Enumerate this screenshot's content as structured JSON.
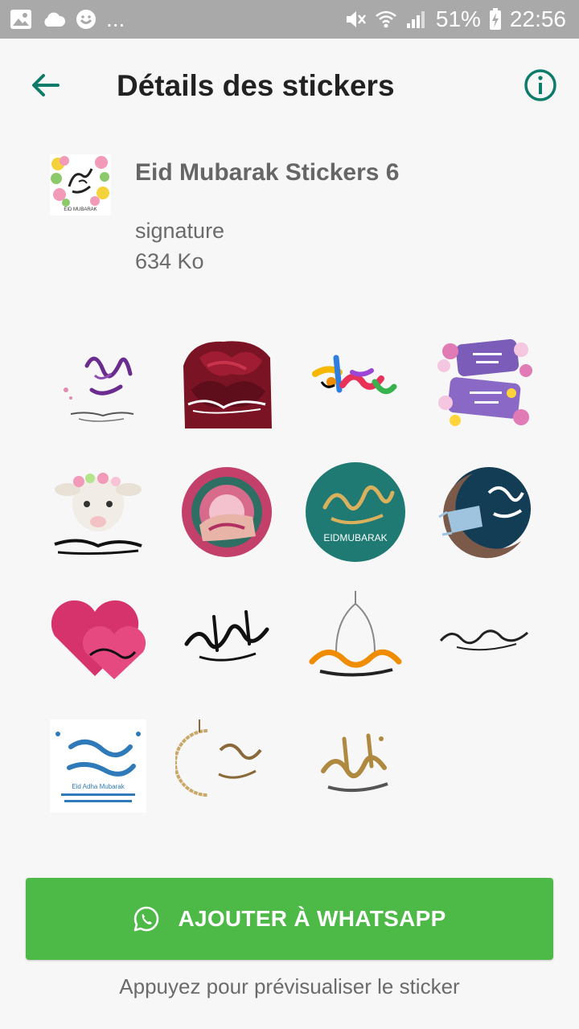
{
  "status_bar": {
    "battery": "51%",
    "time": "22:56",
    "more": "..."
  },
  "app_bar": {
    "title": "Détails des stickers"
  },
  "pack": {
    "name": "Eid Mubarak Stickers 6",
    "author": "signature",
    "size": "634 Ko",
    "thumb_text": "EID MUBARAK"
  },
  "stickers": [
    {
      "icon": "purple-calligraphy-crescent-sticker"
    },
    {
      "icon": "red-rose-calligraphy-sticker"
    },
    {
      "icon": "colorful-eid-calligraphy-sticker"
    },
    {
      "icon": "purple-ribbon-flowers-sticker"
    },
    {
      "icon": "sheep-flower-crown-sticker"
    },
    {
      "icon": "pink-mandala-sticker"
    },
    {
      "icon": "teal-circle-eidmubarak-sticker",
      "label": "EIDMUBARAK"
    },
    {
      "icon": "crescent-mask-sticker"
    },
    {
      "icon": "pink-hearts-sticker"
    },
    {
      "icon": "black-calligraphy-sticker"
    },
    {
      "icon": "mosque-dome-calligraphy-sticker"
    },
    {
      "icon": "small-black-calligraphy-sticker"
    },
    {
      "icon": "eid-adha-blue-card-sticker",
      "label": "Eid Adha Mubarak"
    },
    {
      "icon": "gold-crescent-calligraphy-sticker"
    },
    {
      "icon": "gold-eid-mubarak-sticker"
    }
  ],
  "actions": {
    "add_label": "AJOUTER À WHATSAPP",
    "hint": "Appuyez pour prévisualiser le sticker"
  },
  "colors": {
    "accent": "#0e7c6b",
    "button": "#4db947",
    "status_bar": "#a9a9a9"
  }
}
